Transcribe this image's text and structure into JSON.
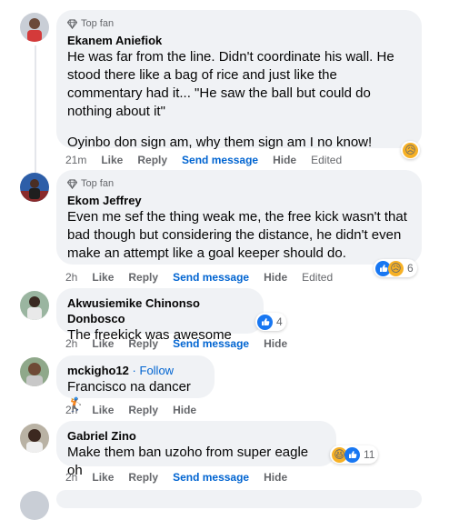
{
  "ui": {
    "top_fan_label": "Top fan",
    "like_label": "Like",
    "reply_label": "Reply",
    "send_message_label": "Send message",
    "hide_label": "Hide",
    "edited_label": "Edited"
  },
  "comments": [
    {
      "name": "Ekanem Aniefiok",
      "top_fan": true,
      "paragraphs": [
        "He was far from the line. Didn't coordinate his wall. He stood there like a bag of rice and just like the commentary had it... \"He saw the ball but could do nothing about it\"",
        "Oyinbo don sign am, why them sign am I no know!"
      ],
      "time": "21m",
      "edited": true,
      "reactions": [
        "sad"
      ],
      "reaction_count": ""
    },
    {
      "name": "Ekom Jeffrey",
      "top_fan": true,
      "paragraphs": [
        "Even me sef the thing weak me, the free kick wasn't that bad though but considering the distance, he didn't even make an attempt like a goal keeper should do."
      ],
      "time": "2h",
      "edited": true,
      "reactions": [
        "like",
        "sad"
      ],
      "reaction_count": "6"
    },
    {
      "name": "Akwusiemike Chinonso Donbosco",
      "top_fan": false,
      "paragraphs": [
        "The freekick was awesome"
      ],
      "time": "2h",
      "edited": false,
      "reactions": [
        "like"
      ],
      "reaction_count": "4"
    },
    {
      "name": "mckigho12",
      "follow_label": "Follow",
      "top_fan": false,
      "paragraphs": [
        "Francisco na dancer 🏌"
      ],
      "time": "2h",
      "edited": false,
      "reactions": [],
      "reaction_count": ""
    },
    {
      "name": "Gabriel Zino",
      "top_fan": false,
      "paragraphs": [
        "Make them ban uzoho from super eagle oh"
      ],
      "time": "2h",
      "edited": false,
      "reactions": [
        "haha",
        "like"
      ],
      "reaction_count": "11"
    }
  ],
  "colors": {
    "bubble": "#f0f2f5",
    "link_blue": "#0064d1",
    "meta_gray": "#65676b",
    "like_blue": "#1877f2"
  }
}
